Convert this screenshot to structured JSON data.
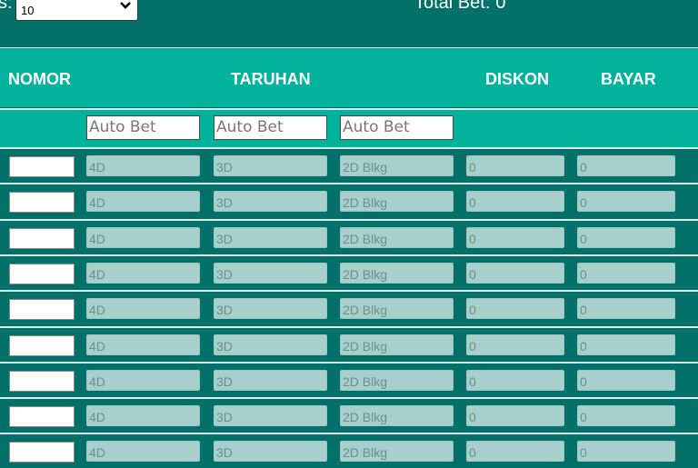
{
  "top": {
    "rows_label": "s:",
    "rows_select_value": "10",
    "total_label": "Total Bet:",
    "total_value": "0"
  },
  "header": {
    "nomor": "NOMOR",
    "taruhan": "TARUHAN",
    "diskon": "DISKON",
    "bayar": "BAYAR"
  },
  "autobet": {
    "placeholders": [
      "Auto Bet",
      "Auto Bet",
      "Auto Bet"
    ]
  },
  "rows": [
    {
      "nomor": "",
      "p4d": "4D",
      "p3d": "3D",
      "p2d": "2D Blkg",
      "diskon": "0",
      "bayar": "0"
    },
    {
      "nomor": "",
      "p4d": "4D",
      "p3d": "3D",
      "p2d": "2D Blkg",
      "diskon": "0",
      "bayar": "0"
    },
    {
      "nomor": "",
      "p4d": "4D",
      "p3d": "3D",
      "p2d": "2D Blkg",
      "diskon": "0",
      "bayar": "0"
    },
    {
      "nomor": "",
      "p4d": "4D",
      "p3d": "3D",
      "p2d": "2D Blkg",
      "diskon": "0",
      "bayar": "0"
    },
    {
      "nomor": "",
      "p4d": "4D",
      "p3d": "3D",
      "p2d": "2D Blkg",
      "diskon": "0",
      "bayar": "0"
    },
    {
      "nomor": "",
      "p4d": "4D",
      "p3d": "3D",
      "p2d": "2D Blkg",
      "diskon": "0",
      "bayar": "0"
    },
    {
      "nomor": "",
      "p4d": "4D",
      "p3d": "3D",
      "p2d": "2D Blkg",
      "diskon": "0",
      "bayar": "0"
    },
    {
      "nomor": "",
      "p4d": "4D",
      "p3d": "3D",
      "p2d": "2D Blkg",
      "diskon": "0",
      "bayar": "0"
    },
    {
      "nomor": "",
      "p4d": "4D",
      "p3d": "3D",
      "p2d": "2D Blkg",
      "diskon": "0",
      "bayar": "0"
    }
  ],
  "colors": {
    "page_bg": "#04706a",
    "header_bg": "#00b39a",
    "disabled_field": "#a7cfcb"
  },
  "icons": {
    "select_arrow": "chevron-down-icon"
  }
}
